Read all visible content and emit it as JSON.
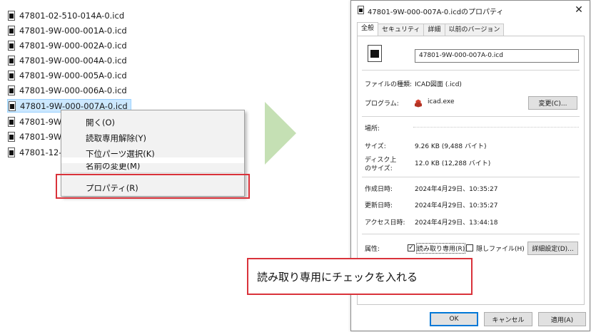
{
  "file_list": [
    {
      "name": "47801-02-510-014A-0.icd",
      "selected": false
    },
    {
      "name": "47801-9W-000-001A-0.icd",
      "selected": false
    },
    {
      "name": "47801-9W-000-002A-0.icd",
      "selected": false
    },
    {
      "name": "47801-9W-000-004A-0.icd",
      "selected": false
    },
    {
      "name": "47801-9W-000-005A-0.icd",
      "selected": false
    },
    {
      "name": "47801-9W-000-006A-0.icd",
      "selected": false
    },
    {
      "name": "47801-9W-000-007A-0.icd",
      "selected": true
    },
    {
      "name": "47801-9W-",
      "selected": false
    },
    {
      "name": "47801-9W-",
      "selected": false
    },
    {
      "name": "47801-12-(",
      "selected": false
    }
  ],
  "context_menu": {
    "items": [
      "開く(O)",
      "読取専用解除(Y)",
      "下位パーツ選択(K)",
      "名前の変更(M)",
      "プロパティ(R)"
    ]
  },
  "dialog": {
    "title": "47801-9W-000-007A-0.icdのプロパティ",
    "close": "✕",
    "tabs": [
      "全般",
      "セキュリティ",
      "詳細",
      "以前のバージョン"
    ],
    "file_name": "47801-9W-000-007A-0.icd",
    "file_type_label": "ファイルの種類:",
    "file_type_value": "ICAD図面 (.icd)",
    "program_label": "プログラム:",
    "program_value": "icad.exe",
    "change_button": "変更(C)...",
    "location_label": "場所:",
    "size_label": "サイズ:",
    "size_value": "9.26 KB (9,488 バイト)",
    "disk_size_label_1": "ディスク上",
    "disk_size_label_2": "のサイズ:",
    "disk_size_value": "12.0 KB (12,288 バイト)",
    "created_label": "作成日時:",
    "created_value": "2024年4月29日、10:35:27",
    "modified_label": "更新日時:",
    "modified_value": "2024年4月29日、10:35:27",
    "accessed_label": "アクセス日時:",
    "accessed_value": "2024年4月29日、13:44:18",
    "attributes_label": "属性:",
    "readonly_label": "読み取り専用(R)",
    "readonly_checked": true,
    "hidden_label": "隠しファイル(H)",
    "hidden_checked": false,
    "advanced_button": "詳細設定(D)...",
    "ok_button": "OK",
    "cancel_button": "キャンセル",
    "apply_button": "適用(A)"
  },
  "callout": {
    "text": "読み取り専用にチェックを入れる"
  },
  "colors": {
    "highlight_border": "#d9323a",
    "arrow": "#c5e0b4",
    "selection": "#cce8ff"
  },
  "icons": [
    "file-icon",
    "gear-app-icon",
    "close-icon",
    "checkbox"
  ]
}
